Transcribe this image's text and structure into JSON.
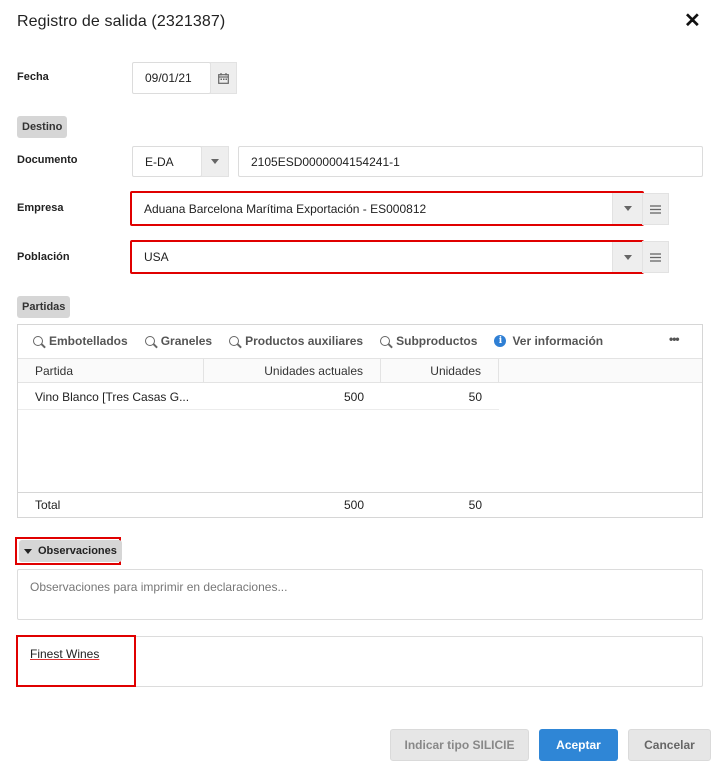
{
  "dialog": {
    "title": "Registro de salida (2321387)",
    "close_icon": "close-icon"
  },
  "fecha": {
    "label": "Fecha",
    "value": "09/01/21",
    "icon": "calendar-icon"
  },
  "destino": {
    "section_label": "Destino",
    "documento": {
      "label": "Documento",
      "type_value": "E-DA",
      "number_value": "2105ESD0000004154241-1"
    },
    "empresa": {
      "label": "Empresa",
      "value": "Aduana Barcelona Marítima Exportación - ES000812"
    },
    "poblacion": {
      "label": "Población",
      "value": "USA"
    }
  },
  "partidas": {
    "section_label": "Partidas",
    "toolbar": [
      {
        "label": "Embotellados",
        "icon": "search-icon"
      },
      {
        "label": "Graneles",
        "icon": "search-icon"
      },
      {
        "label": "Productos auxiliares",
        "icon": "search-icon"
      },
      {
        "label": "Subproductos",
        "icon": "search-icon"
      },
      {
        "label": "Ver información",
        "icon": "info-icon"
      }
    ],
    "more_icon": "•••",
    "columns": [
      "Partida",
      "Unidades actuales",
      "Unidades"
    ],
    "rows": [
      {
        "partida": "Vino Blanco [Tres Casas G...",
        "unidades_actuales": "500",
        "unidades": "50"
      }
    ],
    "footer": {
      "label": "Total",
      "unidades_actuales": "500",
      "unidades": "50"
    }
  },
  "observaciones": {
    "section_label": "Observaciones",
    "placeholder": "Observaciones para imprimir en declaraciones...",
    "second_value": "Finest Wines"
  },
  "buttons": {
    "silicie": "Indicar tipo SILICIE",
    "aceptar": "Aceptar",
    "cancelar": "Cancelar"
  },
  "colors": {
    "accent": "#2f86d6",
    "highlight": "#e00000",
    "section_bg": "#d6d6d6"
  }
}
